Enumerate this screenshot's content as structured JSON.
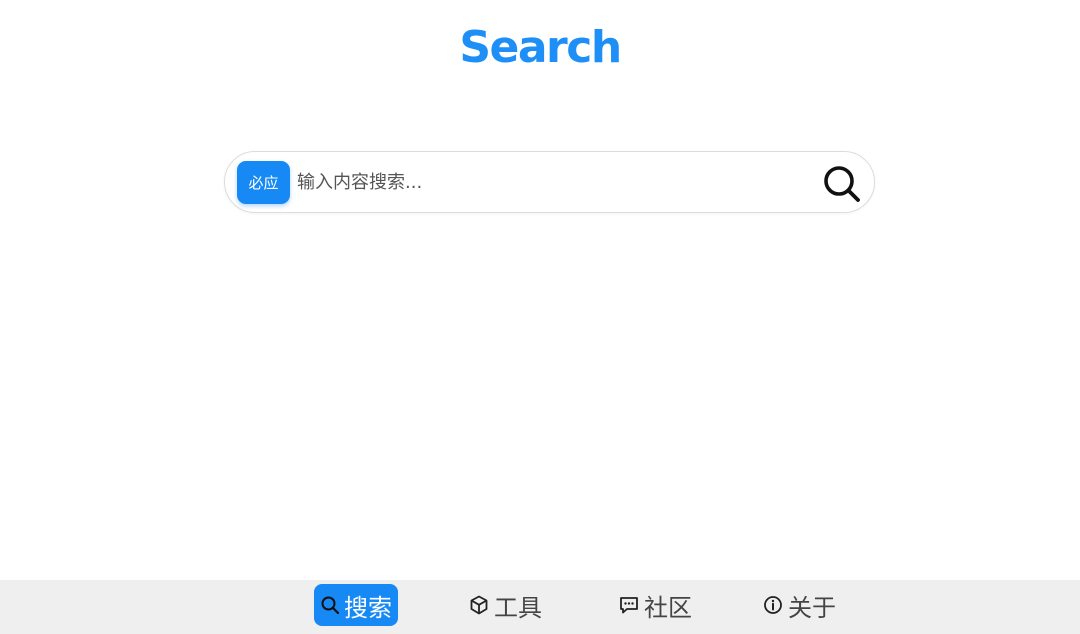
{
  "brand": {
    "title": "Search"
  },
  "search": {
    "engine_label": "必应",
    "placeholder": "输入内容搜索...",
    "value": ""
  },
  "nav": {
    "items": [
      {
        "label": "搜索",
        "icon": "search-icon",
        "active": true
      },
      {
        "label": "工具",
        "icon": "cube-icon",
        "active": false
      },
      {
        "label": "社区",
        "icon": "chat-icon",
        "active": false
      },
      {
        "label": "关于",
        "icon": "info-icon",
        "active": false
      }
    ]
  },
  "colors": {
    "accent": "#1e8ff7",
    "nav_background": "#efefef"
  }
}
